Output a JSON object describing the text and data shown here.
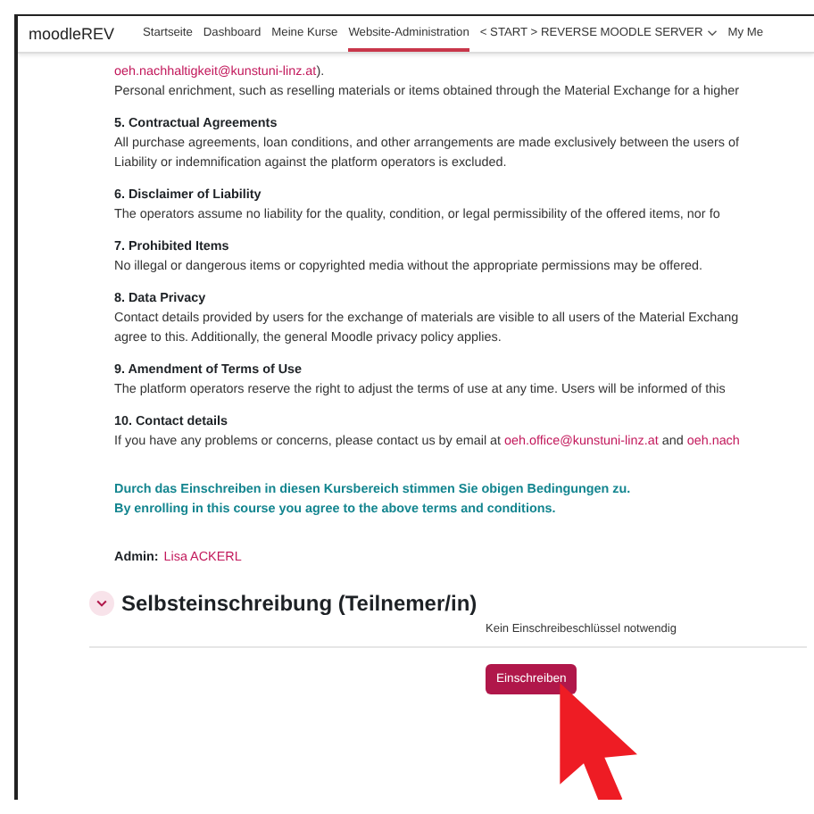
{
  "nav": {
    "brand": "moodleREV",
    "items": [
      {
        "label": "Startseite",
        "selected": false,
        "has_menu": false
      },
      {
        "label": "Dashboard",
        "selected": false,
        "has_menu": false
      },
      {
        "label": "Meine Kurse",
        "selected": false,
        "has_menu": false
      },
      {
        "label": "Website-Administration",
        "selected": true,
        "has_menu": false
      },
      {
        "label": "< START > REVERSE MOODLE SERVER",
        "selected": false,
        "has_menu": true
      },
      {
        "label": "My Me",
        "selected": false,
        "has_menu": false
      }
    ]
  },
  "terms": [
    {
      "paragraphs": [
        [
          {
            "kind": "link",
            "text": "oeh.nachhaltigkeit@kunstuni-linz.at"
          },
          {
            "kind": "text",
            "text": ")."
          }
        ],
        [
          {
            "kind": "text",
            "text": "Personal enrichment, such as reselling materials or items obtained through the Material Exchange for a higher"
          }
        ]
      ]
    },
    {
      "heading": "5. Contractual Agreements",
      "paragraphs": [
        [
          {
            "kind": "text",
            "text": "All purchase agreements, loan conditions, and other arrangements are made exclusively between the users of"
          }
        ],
        [
          {
            "kind": "text",
            "text": "Liability or indemnification against the platform operators is excluded."
          }
        ]
      ]
    },
    {
      "heading": "6. Disclaimer of Liability",
      "paragraphs": [
        [
          {
            "kind": "text",
            "text": "The operators assume no liability for the quality, condition, or legal permissibility of the offered items, nor fo"
          }
        ]
      ]
    },
    {
      "heading": "7. Prohibited Items",
      "paragraphs": [
        [
          {
            "kind": "text",
            "text": "No illegal or dangerous items or copyrighted media without the appropriate permissions may be offered."
          }
        ]
      ]
    },
    {
      "heading": "8. Data Privacy",
      "paragraphs": [
        [
          {
            "kind": "text",
            "text": "Contact details provided by users for the exchange of materials are visible to all users of the Material Exchang"
          }
        ],
        [
          {
            "kind": "text",
            "text": "agree to this. Additionally, the general Moodle privacy policy applies."
          }
        ]
      ]
    },
    {
      "heading": "9. Amendment of Terms of Use",
      "paragraphs": [
        [
          {
            "kind": "text",
            "text": "The platform operators reserve the right to adjust the terms of use at any time. Users will be informed of this"
          }
        ]
      ]
    },
    {
      "heading": "10. Contact details",
      "paragraphs": [
        [
          {
            "kind": "text",
            "text": "If you have any problems or concerns, please contact us by email at "
          },
          {
            "kind": "link",
            "text": "oeh.office@kunstuni-linz.at"
          },
          {
            "kind": "text",
            "text": " and "
          },
          {
            "kind": "link",
            "text": "oeh.nach"
          }
        ]
      ]
    }
  ],
  "notice": [
    "Durch das Einschreiben in diesen Kursbereich stimmen Sie obigen Bedingungen zu.",
    "By enrolling in this course you agree to the above terms and conditions."
  ],
  "admin": {
    "label": "Admin:",
    "name": "Lisa ACKERL"
  },
  "enrolment": {
    "title": "Selbsteinschreibung (Teilnemer/in)",
    "expanded": true,
    "note": "Kein Einschreibeschlüssel notwendig",
    "button": "Einschreiben"
  }
}
